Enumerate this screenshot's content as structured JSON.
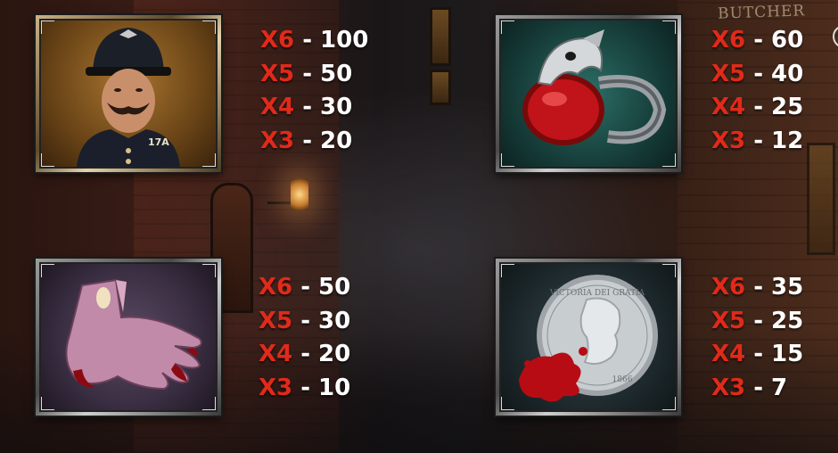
{
  "background": {
    "sign_text": "BUTCHER"
  },
  "colors": {
    "multiplier": "#e02a1a",
    "value": "#ffffff"
  },
  "symbols": [
    {
      "name": "policeman",
      "icon": "policeman-icon",
      "badge_text": "17A",
      "payouts": [
        {
          "mult": "X6",
          "sep": " - ",
          "value": "100"
        },
        {
          "mult": "X5",
          "sep": " - ",
          "value": "50"
        },
        {
          "mult": "X4",
          "sep": " - ",
          "value": "30"
        },
        {
          "mult": "X3",
          "sep": " - ",
          "value": "20"
        }
      ]
    },
    {
      "name": "ring",
      "icon": "raven-ring-icon",
      "payouts": [
        {
          "mult": "X6",
          "sep": " - ",
          "value": "60"
        },
        {
          "mult": "X5",
          "sep": " - ",
          "value": "40"
        },
        {
          "mult": "X4",
          "sep": " - ",
          "value": "25"
        },
        {
          "mult": "X3",
          "sep": " - ",
          "value": "12"
        }
      ]
    },
    {
      "name": "gloves",
      "icon": "gloves-icon",
      "payouts": [
        {
          "mult": "X6",
          "sep": " - ",
          "value": "50"
        },
        {
          "mult": "X5",
          "sep": " - ",
          "value": "30"
        },
        {
          "mult": "X4",
          "sep": " - ",
          "value": "20"
        },
        {
          "mult": "X3",
          "sep": " - ",
          "value": "10"
        }
      ]
    },
    {
      "name": "coin",
      "icon": "bloody-coin-icon",
      "coin_text": "VICTORIA DEI GRATIA",
      "coin_year": "1866",
      "payouts": [
        {
          "mult": "X6",
          "sep": " - ",
          "value": "35"
        },
        {
          "mult": "X5",
          "sep": " - ",
          "value": "25"
        },
        {
          "mult": "X4",
          "sep": " - ",
          "value": "15"
        },
        {
          "mult": "X3",
          "sep": " - ",
          "value": "7"
        }
      ]
    }
  ]
}
